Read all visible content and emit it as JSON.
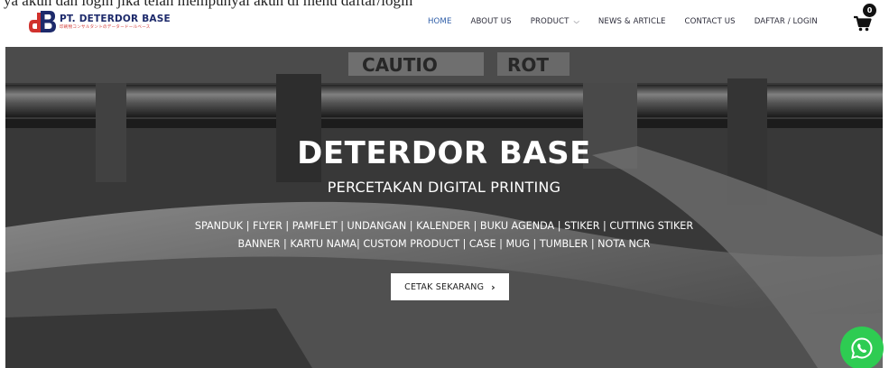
{
  "top_text": "ya akun dan login jika telah mempunyai akun di menu daftar/login",
  "brand": {
    "title": "PT. DETERDOR BASE",
    "subtitle": "印刷物コンサルタントのデータードールベース",
    "colors": {
      "navy": "#1d2a6b",
      "red": "#d0312d"
    }
  },
  "nav": {
    "items": [
      {
        "label": "HOME",
        "active": true
      },
      {
        "label": "ABOUT US"
      },
      {
        "label": "PRODUCT",
        "has_dropdown": true
      },
      {
        "label": "NEWS & ARTICLE"
      },
      {
        "label": "CONTACT US"
      },
      {
        "label": "DAFTAR / LOGIN"
      }
    ],
    "cart_count": "0",
    "cart_icon": "shopping-cart-icon"
  },
  "hero": {
    "title": "DETERDOR BASE",
    "subtitle": "PERCETAKAN DIGITAL PRINTING",
    "products_line1": "SPANDUK | FLYER | PAMFLET | UNDANGAN | KALENDER | BUKU AGENDA | STIKER | CUTTING STIKER",
    "products_line2": "BANNER | KARTU NAMA| CUSTOM PRODUCT | CASE | MUG | TUMBLER | NOTA NCR",
    "cta_label": "CETAK SEKARANG",
    "banner_text_left": "CAUTIO",
    "banner_text_right": "ROT"
  },
  "whatsapp": {
    "icon": "whatsapp-icon",
    "color": "#2ecc52"
  }
}
